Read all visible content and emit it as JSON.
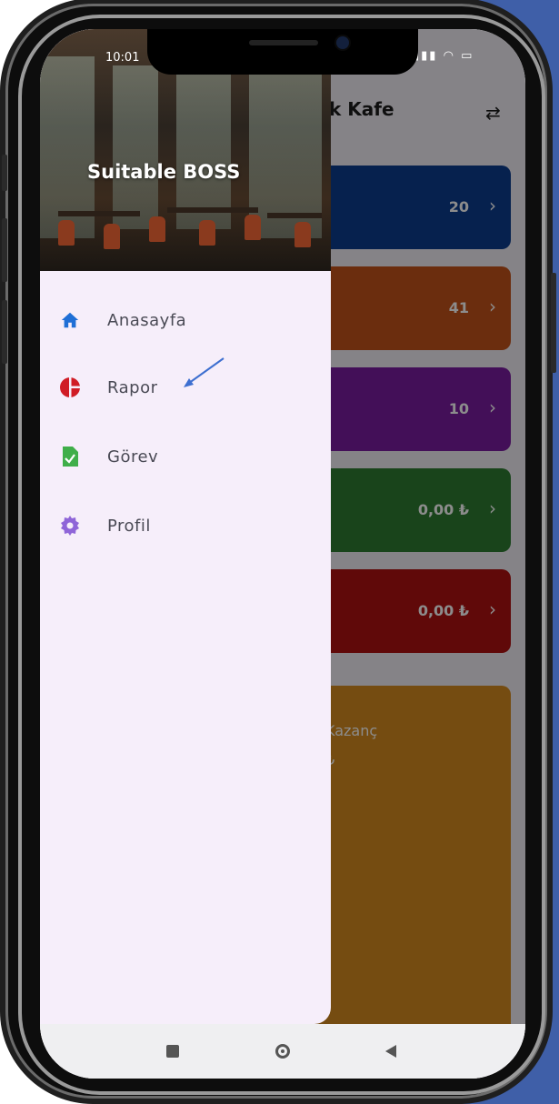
{
  "status_bar": {
    "time": "10:01",
    "icons": "▮▮▮ ◠ ▭"
  },
  "app": {
    "title": "k Kafe",
    "swap_icon": "swap-icon",
    "cards": [
      {
        "value": "20",
        "color": "#0b3d8f"
      },
      {
        "value": "41",
        "color": "#c4531b"
      },
      {
        "value": "10",
        "color": "#7b1da0"
      },
      {
        "value": "0,00 ₺",
        "color": "#2e7d32"
      },
      {
        "value": "0,00 ₺",
        "color": "#b01212"
      }
    ],
    "big_card": {
      "label": "Kazanç",
      "amount": "₺",
      "color": "#d68a20"
    }
  },
  "drawer": {
    "brand": "Suitable BOSS",
    "items": [
      {
        "label": "Anasayfa",
        "icon": "home-icon",
        "color": "#1f6fd6"
      },
      {
        "label": "Rapor",
        "icon": "pie-chart-icon",
        "color": "#d01c25"
      },
      {
        "label": "Görev",
        "icon": "task-icon",
        "color": "#3fae49"
      },
      {
        "label": "Profil",
        "icon": "gear-icon",
        "color": "#8f65d8"
      }
    ]
  },
  "nav": {
    "buttons": [
      "square-icon",
      "circle-icon",
      "back-icon"
    ]
  },
  "annotation": {
    "arrow_color": "#3d6fd0"
  }
}
